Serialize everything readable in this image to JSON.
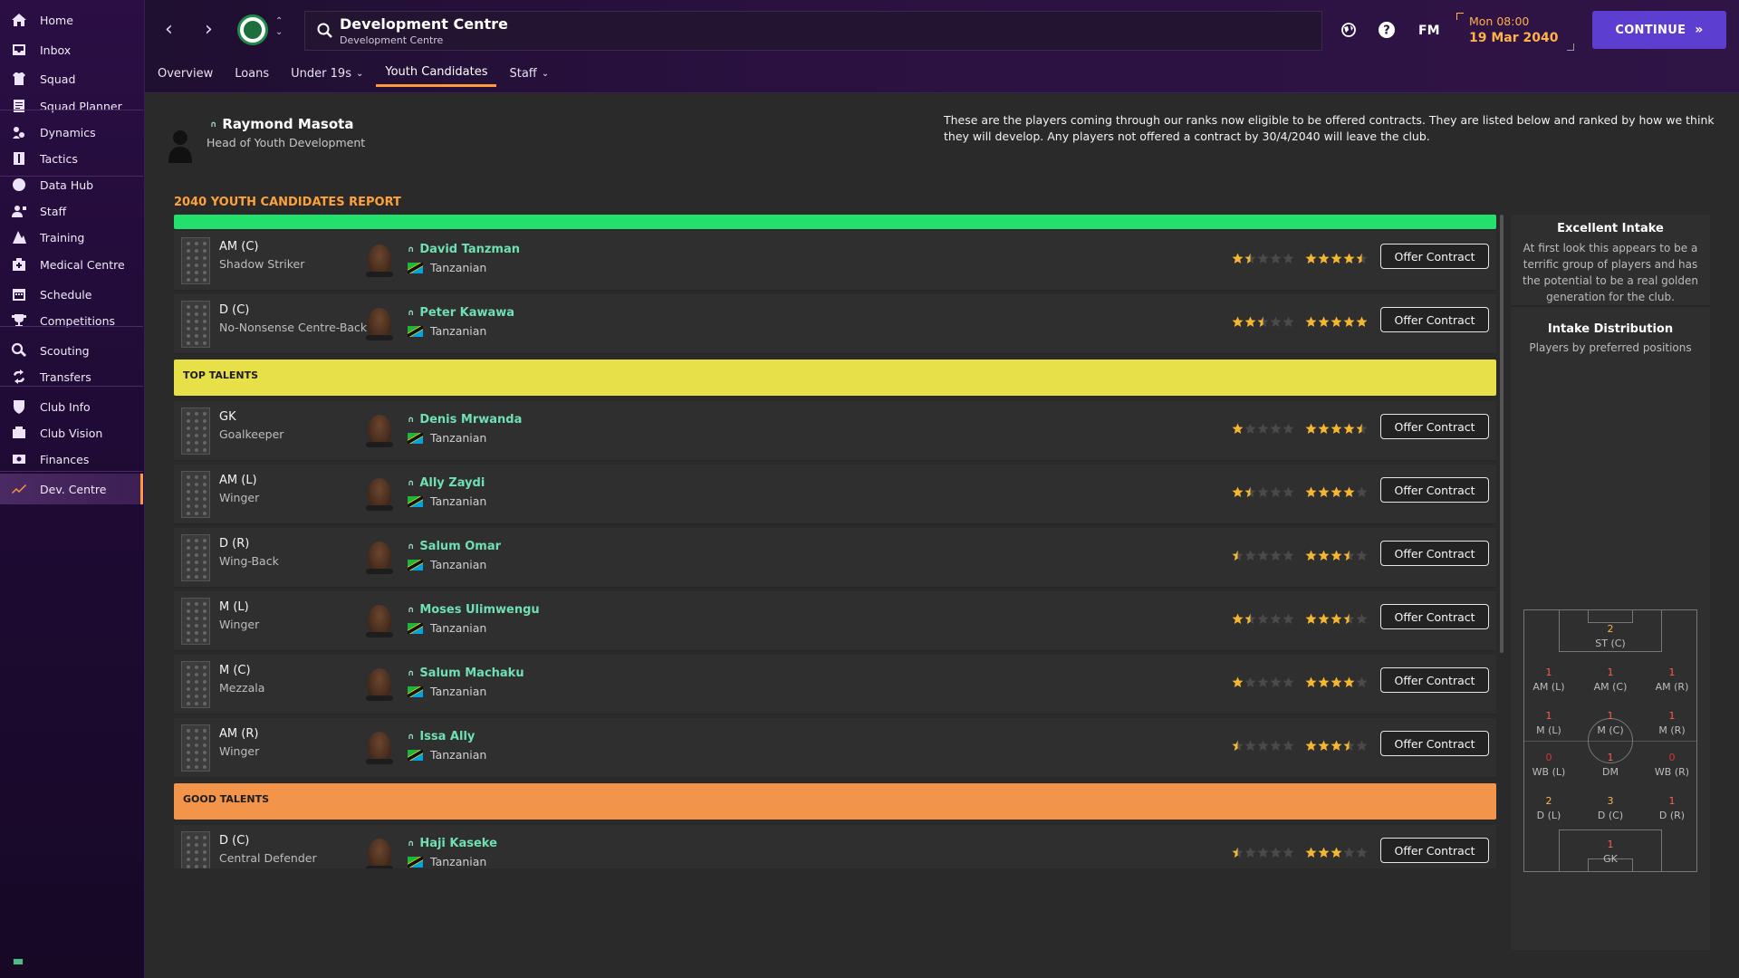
{
  "sidebar": {
    "items": [
      {
        "label": "Home",
        "icon": "home-icon"
      },
      {
        "label": "Inbox",
        "icon": "inbox-icon"
      },
      {
        "label": "Squad",
        "icon": "squad-icon"
      },
      {
        "label": "Squad Planner",
        "icon": "squad-planner-icon"
      },
      {
        "label": "Dynamics",
        "icon": "dynamics-icon"
      },
      {
        "label": "Tactics",
        "icon": "tactics-icon"
      },
      {
        "label": "Data Hub",
        "icon": "data-hub-icon"
      },
      {
        "label": "Staff",
        "icon": "staff-icon"
      },
      {
        "label": "Training",
        "icon": "training-icon"
      },
      {
        "label": "Medical Centre",
        "icon": "medical-centre-icon"
      },
      {
        "label": "Schedule",
        "icon": "schedule-icon"
      },
      {
        "label": "Competitions",
        "icon": "trophy-icon"
      },
      {
        "label": "Scouting",
        "icon": "scouting-icon"
      },
      {
        "label": "Transfers",
        "icon": "transfers-icon"
      },
      {
        "label": "Club Info",
        "icon": "club-info-icon"
      },
      {
        "label": "Club Vision",
        "icon": "club-vision-icon"
      },
      {
        "label": "Finances",
        "icon": "finances-icon"
      },
      {
        "label": "Dev. Centre",
        "icon": "dev-centre-icon"
      }
    ],
    "active": "Dev. Centre"
  },
  "header": {
    "title": "Development Centre",
    "subtitle": "Development Centre",
    "fm_label": "FM",
    "date_time": "Mon 08:00",
    "date_day": "19 Mar 2040",
    "continue_label": "CONTINUE",
    "tabs": [
      {
        "label": "Overview",
        "dropdown": false
      },
      {
        "label": "Loans",
        "dropdown": false
      },
      {
        "label": "Under 19s",
        "dropdown": true
      },
      {
        "label": "Youth Candidates",
        "dropdown": false,
        "active": true
      },
      {
        "label": "Staff",
        "dropdown": true
      }
    ]
  },
  "head_of_youth": {
    "name": "Raymond Masota",
    "role": "Head of Youth Development"
  },
  "intro_text": "These are the players coming through our ranks now eligible to be offered contracts. They are listed below and ranked by how we think they will develop. Any players not offered a contract by 30/4/2040 will leave the club.",
  "report_title": "2040 YOUTH CANDIDATES REPORT",
  "groups": [
    {
      "label": "",
      "color": "#22e06b",
      "players": [
        {
          "pos": "AM (C)",
          "role": "Shadow Striker",
          "name": "David Tanzman",
          "nationality": "Tanzanian",
          "ability": 1.5,
          "potential": 4.5
        },
        {
          "pos": "D (C)",
          "role": "No-Nonsense Centre-Back",
          "name": "Peter Kawawa",
          "nationality": "Tanzanian",
          "ability": 2.5,
          "potential": 5
        }
      ]
    },
    {
      "label": "TOP TALENTS",
      "color": "#e8e049",
      "players": [
        {
          "pos": "GK",
          "role": "Goalkeeper",
          "name": "Denis Mrwanda",
          "nationality": "Tanzanian",
          "ability": 1,
          "potential": 4.5
        },
        {
          "pos": "AM (L)",
          "role": "Winger",
          "name": "Ally Zaydi",
          "nationality": "Tanzanian",
          "ability": 1.5,
          "potential": 4
        },
        {
          "pos": "D (R)",
          "role": "Wing-Back",
          "name": "Salum Omar",
          "nationality": "Tanzanian",
          "ability": 0.5,
          "potential": 3.5
        },
        {
          "pos": "M (L)",
          "role": "Winger",
          "name": "Moses Ulimwengu",
          "nationality": "Tanzanian",
          "ability": 1.5,
          "potential": 3.5
        },
        {
          "pos": "M (C)",
          "role": "Mezzala",
          "name": "Salum Machaku",
          "nationality": "Tanzanian",
          "ability": 1,
          "potential": 4
        },
        {
          "pos": "AM (R)",
          "role": "Winger",
          "name": "Issa Ally",
          "nationality": "Tanzanian",
          "ability": 0.5,
          "potential": 3.5
        }
      ]
    },
    {
      "label": "GOOD TALENTS",
      "color": "#f2954a",
      "players": [
        {
          "pos": "D (C)",
          "role": "Central Defender",
          "name": "Haji Kaseke",
          "nationality": "Tanzanian",
          "ability": 0.5,
          "potential": 3
        }
      ]
    }
  ],
  "offer_label": "Offer Contract",
  "right_panel": {
    "intake_title": "Excellent Intake",
    "intake_text": "At first look this appears to be a terrific group of players and has the potential to be a real golden generation for the club.",
    "dist_title": "Intake Distribution",
    "dist_sub": "Players by preferred positions",
    "positions": [
      {
        "pos": "ST (C)",
        "count": "2"
      },
      {
        "pos": "AM (L)",
        "count": "1"
      },
      {
        "pos": "AM (C)",
        "count": "1"
      },
      {
        "pos": "AM (R)",
        "count": "1"
      },
      {
        "pos": "M (L)",
        "count": "1"
      },
      {
        "pos": "M (C)",
        "count": "1"
      },
      {
        "pos": "M (R)",
        "count": "1"
      },
      {
        "pos": "WB (L)",
        "count": "0"
      },
      {
        "pos": "DM",
        "count": "1"
      },
      {
        "pos": "WB (R)",
        "count": "0"
      },
      {
        "pos": "D (L)",
        "count": "2"
      },
      {
        "pos": "D (C)",
        "count": "3"
      },
      {
        "pos": "D (R)",
        "count": "1"
      },
      {
        "pos": "GK",
        "count": "1"
      }
    ]
  }
}
